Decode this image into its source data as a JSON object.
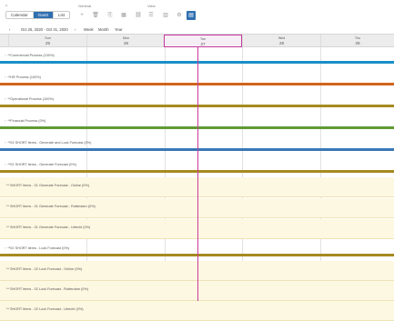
{
  "toolbar": {
    "view_modes": [
      "Calendar",
      "Gantt",
      "List"
    ],
    "active_view": "Gantt",
    "general_label": "General",
    "view_label": "View"
  },
  "nav": {
    "range": "Oct 25, 2020 - Oct 31, 2020",
    "scales": [
      "Week",
      "Month",
      "Year"
    ]
  },
  "timeline": {
    "days": [
      {
        "name": "Sun",
        "num": "25"
      },
      {
        "name": "Mon",
        "num": "26"
      },
      {
        "name": "Tue",
        "num": "27"
      },
      {
        "name": "Wed",
        "num": "28"
      },
      {
        "name": "Thu",
        "num": "29"
      }
    ],
    "today_index": 2
  },
  "colors": {
    "accent": "#2f6fb0",
    "today": "#c73b9d"
  },
  "rows": [
    {
      "label": "**Commercial Process (100%)",
      "bar": "#1a8fc6",
      "sub": false
    },
    {
      "label": "**HR Process (100%)",
      "bar": "#d0651b",
      "sub": false
    },
    {
      "label": "**Operational Process (100%)",
      "bar": "#a68a1f",
      "sub": false
    },
    {
      "label": "**Financial Process (0%)",
      "bar": "#5f9a35",
      "sub": false
    },
    {
      "label": "**03 SHORT items - Generate and Lock Forecast (0%)",
      "bar": "#3878b6",
      "sub": false
    },
    {
      "label": "**02 SHORT items - Generate Forecast (0%)",
      "bar": "#a68a1f",
      "sub": false
    },
    {
      "label": "** SHORT items - 01 Generate Forecast - Online (0%)",
      "bar": "",
      "sub": true
    },
    {
      "label": "** SHORT items - 01 Generate Forecast - Rotterdam (0%)",
      "bar": "",
      "sub": true
    },
    {
      "label": "** SHORT items - 01 Generate Forecast - Utrecht (0%)",
      "bar": "",
      "sub": true
    },
    {
      "label": "**02 SHORT items - Lock Forecast (0%)",
      "bar": "#a68a1f",
      "sub": false
    },
    {
      "label": "** SHORT items - 02 Lock Forecast - Online (0%)",
      "bar": "",
      "sub": true
    },
    {
      "label": "** SHORT items - 02 Lock Forecast - Rotterdam (0%)",
      "bar": "",
      "sub": true
    },
    {
      "label": "** SHORT items - 02 Lock Forecast - Utrecht (0%)",
      "bar": "",
      "sub": true
    }
  ]
}
